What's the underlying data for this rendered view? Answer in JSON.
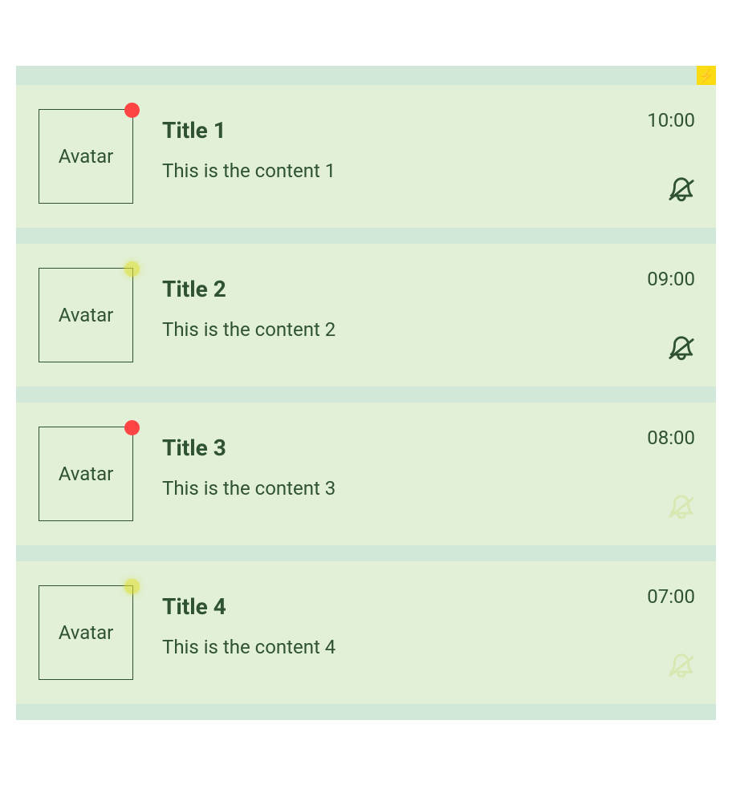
{
  "colors": {
    "panel_bg": "#d1e7d7",
    "item_bg": "#e1f0d6",
    "text": "#2f5233",
    "dot_red": "#f44",
    "dot_yellow": "#e0e030",
    "lightning_bg": "#fadb14"
  },
  "lightning_icon": "⚡",
  "avatar_label": "Avatar",
  "items": [
    {
      "title": "Title 1",
      "content": "This is the content 1",
      "time": "10:00",
      "dot_color": "red",
      "bell_muted": false,
      "icon": "bell-off-icon"
    },
    {
      "title": "Title 2",
      "content": "This is the content 2",
      "time": "09:00",
      "dot_color": "yellow",
      "bell_muted": false,
      "icon": "bell-off-icon"
    },
    {
      "title": "Title 3",
      "content": "This is the content 3",
      "time": "08:00",
      "dot_color": "red",
      "bell_muted": true,
      "icon": "bell-off-icon"
    },
    {
      "title": "Title 4",
      "content": "This is the content 4",
      "time": "07:00",
      "dot_color": "yellow",
      "bell_muted": true,
      "icon": "bell-off-icon"
    }
  ]
}
